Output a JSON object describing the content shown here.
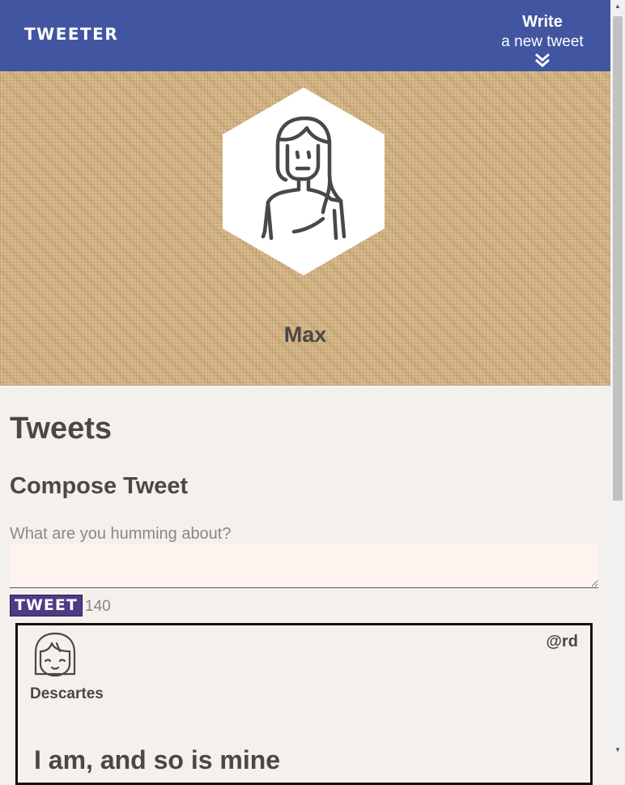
{
  "nav": {
    "brand": "TWEETER",
    "write_title": "Write",
    "write_subtitle": "a new tweet",
    "write_icon": "double-chevron-down-icon"
  },
  "profile": {
    "name": "Max",
    "avatar_icon": "woman-avatar-icon"
  },
  "main": {
    "heading": "Tweets",
    "compose_heading": "Compose Tweet",
    "compose_label": "What are you humming about?",
    "compose_value": "",
    "tweet_button": "TWEET",
    "char_counter": "140"
  },
  "tweet": {
    "name": "Descartes",
    "handle": "@rd",
    "text": "I am, and so is mine",
    "avatar_icon": "girl-avatar-icon"
  },
  "colors": {
    "nav_bg": "#4155a1",
    "page_bg": "#f4f1ec",
    "header_bg": "#d9bb8c",
    "button_bg": "#4d3b86",
    "input_bg": "#fff3ef"
  }
}
